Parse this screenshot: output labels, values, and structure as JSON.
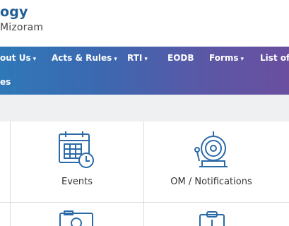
{
  "header": {
    "title": "ogy",
    "subtitle": "Mizoram"
  },
  "nav": {
    "items": [
      {
        "label": "out Us",
        "caret": "▾"
      },
      {
        "label": "Acts & Rules",
        "caret": "▾"
      },
      {
        "label": "RTI",
        "caret": "▾"
      },
      {
        "label": "EODB",
        "caret": ""
      },
      {
        "label": "Forms",
        "caret": "▾"
      },
      {
        "label": "List of F",
        "caret": ""
      }
    ],
    "row2": "es"
  },
  "tiles": [
    {
      "label": "Events",
      "icon": "calendar-icon"
    },
    {
      "label": "OM / Notifications",
      "icon": "alarm-bell-icon"
    }
  ],
  "colors": {
    "accent": "#1f5d95",
    "nav_start": "#2f78b8",
    "nav_end": "#6a4f9f",
    "icon": "#2a6aa8"
  }
}
